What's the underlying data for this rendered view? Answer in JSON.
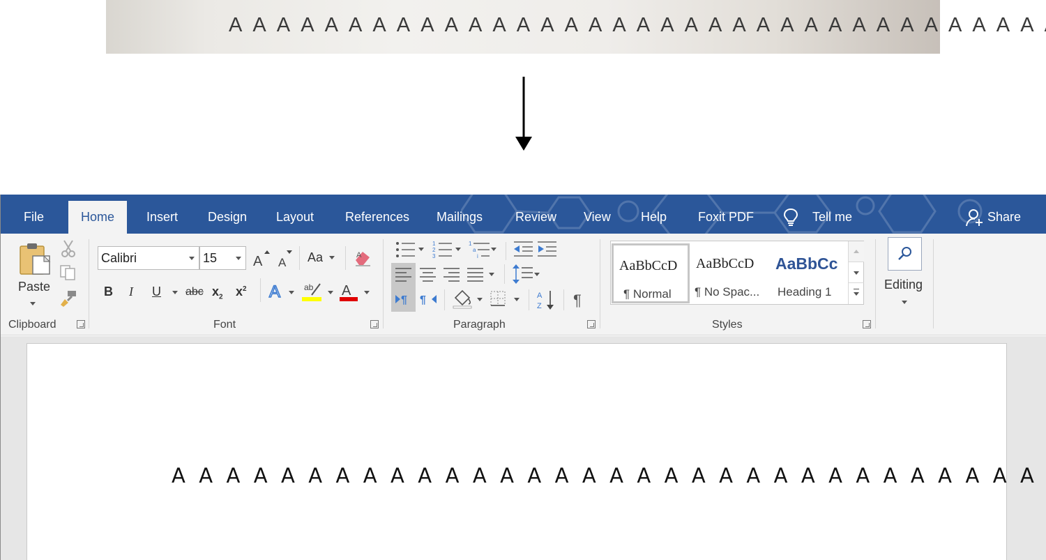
{
  "photo": {
    "text": "A A A A A A A A A A A A A A A A A A A A A A A A A A A A A A A A A A A"
  },
  "tabs": [
    {
      "label": "File",
      "active": false
    },
    {
      "label": "Home",
      "active": true
    },
    {
      "label": "Insert",
      "active": false
    },
    {
      "label": "Design",
      "active": false
    },
    {
      "label": "Layout",
      "active": false
    },
    {
      "label": "References",
      "active": false
    },
    {
      "label": "Mailings",
      "active": false
    },
    {
      "label": "Review",
      "active": false
    },
    {
      "label": "View",
      "active": false
    },
    {
      "label": "Help",
      "active": false
    },
    {
      "label": "Foxit PDF",
      "active": false
    }
  ],
  "tell_me": "Tell me",
  "share": "Share",
  "clipboard": {
    "paste_label": "Paste",
    "group_label": "Clipboard"
  },
  "font": {
    "name": "Calibri",
    "size": "15",
    "change_case": "Aa",
    "bold": "B",
    "italic": "I",
    "underline": "U",
    "strikethrough": "abc",
    "subscript": "x",
    "superscript": "x",
    "group_label": "Font"
  },
  "paragraph": {
    "group_label": "Paragraph"
  },
  "styles": {
    "items": [
      {
        "sample": "AaBbCcD",
        "name": "¶ Normal"
      },
      {
        "sample": "AaBbCcD",
        "name": "¶ No Spac..."
      },
      {
        "sample": "AaBbCc",
        "name": "Heading 1"
      }
    ],
    "group_label": "Styles"
  },
  "editing": {
    "label": "Editing"
  },
  "document": {
    "text": "A A A A A A A A A A A A A A A A A A A A A A A A A A A A A A A A A A A"
  },
  "colors": {
    "ribbon_blue": "#2b579a",
    "highlight": "#ffff00",
    "font_color": "#e00000",
    "heading_blue": "#2f5496"
  }
}
